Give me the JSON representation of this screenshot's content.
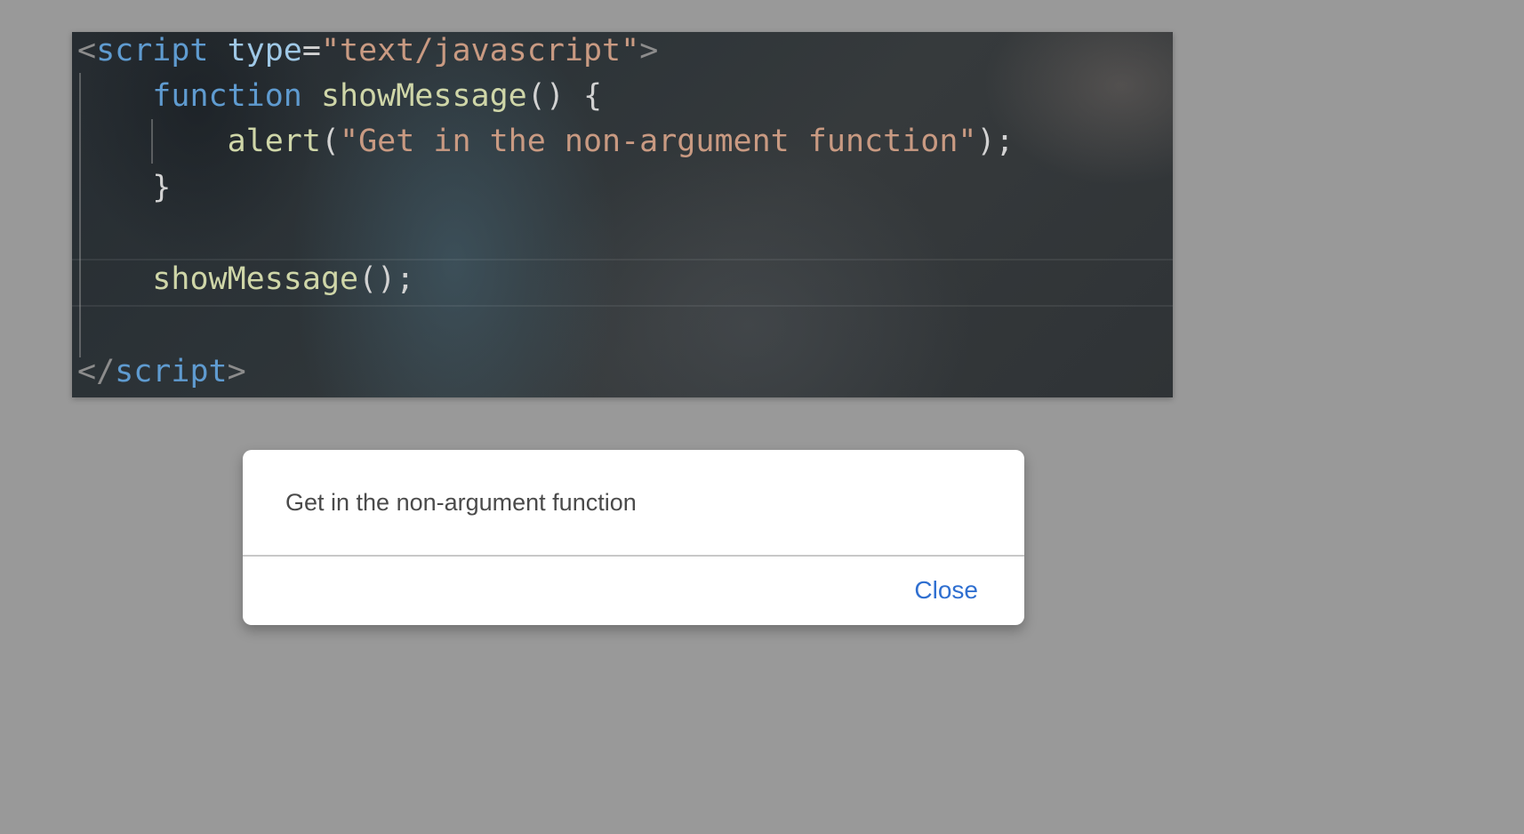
{
  "code": {
    "lines": [
      {
        "tokens": [
          {
            "text": "<",
            "kind": "bracket"
          },
          {
            "text": "script",
            "kind": "tag"
          },
          {
            "text": " ",
            "kind": "punct"
          },
          {
            "text": "type",
            "kind": "attr"
          },
          {
            "text": "=",
            "kind": "punct"
          },
          {
            "text": "\"text/javascript\"",
            "kind": "string"
          },
          {
            "text": ">",
            "kind": "bracket"
          }
        ]
      },
      {
        "tokens": [
          {
            "text": "    ",
            "kind": "punct"
          },
          {
            "text": "function",
            "kind": "keyword"
          },
          {
            "text": " ",
            "kind": "punct"
          },
          {
            "text": "showMessage",
            "kind": "fn"
          },
          {
            "text": "() {",
            "kind": "punct"
          }
        ]
      },
      {
        "tokens": [
          {
            "text": "        ",
            "kind": "punct"
          },
          {
            "text": "alert",
            "kind": "fn"
          },
          {
            "text": "(",
            "kind": "punct"
          },
          {
            "text": "\"Get in the non-argument function\"",
            "kind": "string"
          },
          {
            "text": ");",
            "kind": "punct"
          }
        ]
      },
      {
        "tokens": [
          {
            "text": "    }",
            "kind": "punct"
          }
        ]
      },
      {
        "tokens": []
      },
      {
        "tokens": [
          {
            "text": "    ",
            "kind": "punct"
          },
          {
            "text": "showMessage",
            "kind": "fn"
          },
          {
            "text": "();",
            "kind": "punct"
          }
        ]
      },
      {
        "tokens": []
      },
      {
        "tokens": [
          {
            "text": "</",
            "kind": "bracket"
          },
          {
            "text": "script",
            "kind": "tag"
          },
          {
            "text": ">",
            "kind": "bracket"
          }
        ]
      }
    ]
  },
  "dialog": {
    "message": "Get in the non-argument function",
    "close_label": "Close"
  },
  "colors": {
    "page_background": "#999999",
    "dialog_button": "#2f6fd0",
    "syntax_tag": "#5f9bd0",
    "syntax_string": "#c99a82",
    "syntax_function": "#cfd6a8"
  }
}
